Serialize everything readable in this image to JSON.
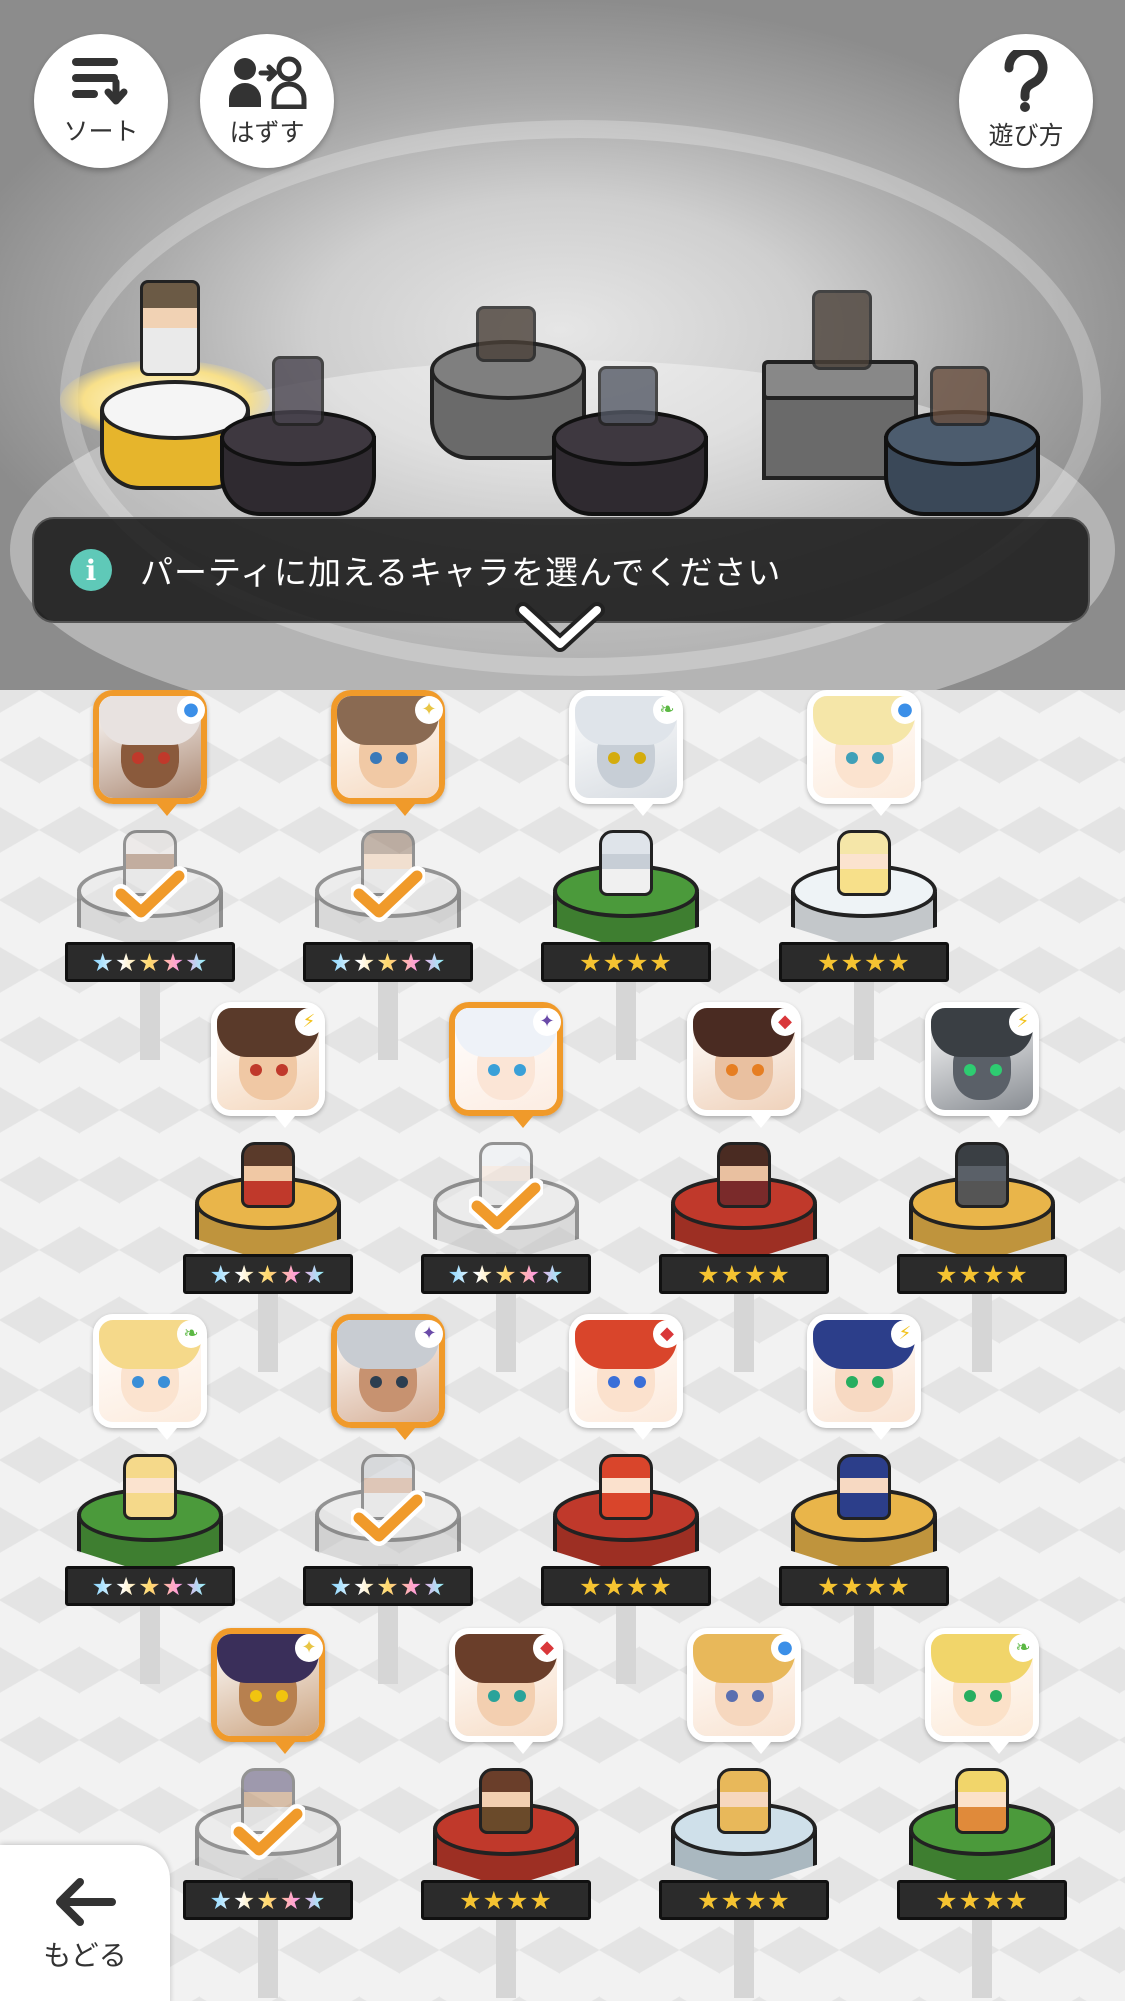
{
  "toolbar": {
    "sort_label": "ソート",
    "remove_label": "はずす",
    "help_label": "遊び方"
  },
  "banner": {
    "message": "パーティに加えるキャラを選んでください"
  },
  "footer": {
    "back_label": "もどる"
  },
  "party_slots": [
    {
      "state": "filled"
    },
    {
      "state": "empty"
    },
    {
      "state": "empty"
    },
    {
      "state": "empty"
    },
    {
      "state": "empty"
    },
    {
      "state": "empty"
    }
  ],
  "characters": [
    {
      "rarity": "★★★★★",
      "stars": 5,
      "selected": true,
      "element": "water-icon",
      "hair": "#e8e2e0",
      "skin": "#8a5a3c",
      "eye": "#c0392b",
      "pedestal": "#e5e5e5",
      "chibi": "#ddd"
    },
    {
      "rarity": "★★★★★",
      "stars": 5,
      "selected": true,
      "element": "light-icon",
      "hair": "#8a6a52",
      "skin": "#f1c9a5",
      "eye": "#3a79b9",
      "pedestal": "#e5e5e5",
      "chibi": "#ddd"
    },
    {
      "rarity": "★★★★",
      "stars": 4,
      "selected": false,
      "element": "wind-icon",
      "hair": "#dfe4ea",
      "skin": "#c7ced6",
      "eye": "#d4ac0d",
      "pedestal": "#4b9a3b",
      "chibi": "#f0f0f0"
    },
    {
      "rarity": "★★★★",
      "stars": 4,
      "selected": false,
      "element": "water-icon",
      "hair": "#f5e6a8",
      "skin": "#fbe3cf",
      "eye": "#3fa0b8",
      "pedestal": "#eef3f6",
      "chibi": "#f7e08a"
    },
    {
      "rarity": "★★★★★",
      "stars": 5,
      "selected": false,
      "element": "thunder-icon",
      "hair": "#5a3a2a",
      "skin": "#f0c8a4",
      "eye": "#c0392b",
      "pedestal": "#e9b54a",
      "chibi": "#c0392b"
    },
    {
      "rarity": "★★★★★",
      "stars": 5,
      "selected": true,
      "element": "dark-icon",
      "hair": "#eef2f8",
      "skin": "#fbe5d6",
      "eye": "#3aa0d8",
      "pedestal": "#e5e5e5",
      "chibi": "#ddd"
    },
    {
      "rarity": "★★★★",
      "stars": 4,
      "selected": false,
      "element": "fire-icon",
      "hair": "#4a2b22",
      "skin": "#e9c0a0",
      "eye": "#e67e22",
      "pedestal": "#c0392b",
      "chibi": "#7a2a2a"
    },
    {
      "rarity": "★★★★",
      "stars": 4,
      "selected": false,
      "element": "thunder-icon",
      "hair": "#3a3f44",
      "skin": "#5a6068",
      "eye": "#2ecc71",
      "pedestal": "#e9b54a",
      "chibi": "#555"
    },
    {
      "rarity": "★★★★★",
      "stars": 5,
      "selected": false,
      "element": "wind-icon",
      "hair": "#f5d98a",
      "skin": "#fbe3cf",
      "eye": "#3a8fd8",
      "pedestal": "#4b9a3b",
      "chibi": "#f5d98a"
    },
    {
      "rarity": "★★★★★",
      "stars": 5,
      "selected": true,
      "element": "dark-icon",
      "hair": "#c8ccd2",
      "skin": "#c79270",
      "eye": "#2c3e50",
      "pedestal": "#e5e5e5",
      "chibi": "#ddd"
    },
    {
      "rarity": "★★★★",
      "stars": 4,
      "selected": false,
      "element": "fire-icon",
      "hair": "#d9452b",
      "skin": "#fbe1cd",
      "eye": "#3a6fd8",
      "pedestal": "#c0392b",
      "chibi": "#d9452b"
    },
    {
      "rarity": "★★★★",
      "stars": 4,
      "selected": false,
      "element": "thunder-icon",
      "hair": "#2c3e8a",
      "skin": "#f7d9c2",
      "eye": "#27ae60",
      "pedestal": "#e9b54a",
      "chibi": "#2c3e8a"
    },
    {
      "rarity": "★★★★★",
      "stars": 5,
      "selected": true,
      "element": "light-icon",
      "hair": "#3a2f5a",
      "skin": "#b7804f",
      "eye": "#f1c40f",
      "pedestal": "#e5e5e5",
      "chibi": "#ddd"
    },
    {
      "rarity": "★★★★",
      "stars": 4,
      "selected": false,
      "element": "fire-icon",
      "hair": "#6a3e2a",
      "skin": "#f3cfb0",
      "eye": "#2aa39a",
      "pedestal": "#c0392b",
      "chibi": "#6a4a2a"
    },
    {
      "rarity": "★★★★",
      "stars": 4,
      "selected": false,
      "element": "water-icon",
      "hair": "#e8b85a",
      "skin": "#f6d7be",
      "eye": "#5a6fb0",
      "pedestal": "#cfe0ea",
      "chibi": "#e8b85a"
    },
    {
      "rarity": "★★★★",
      "stars": 4,
      "selected": false,
      "element": "wind-icon",
      "hair": "#f1d56a",
      "skin": "#fbe1c8",
      "eye": "#27ae60",
      "pedestal": "#4b9a3b",
      "chibi": "#e08a3a"
    }
  ],
  "colors": {
    "selected_border": "#f09a2a",
    "check": "#f09a2a",
    "banner_bg": "#1e1e1e",
    "info": "#5fc9b8"
  }
}
